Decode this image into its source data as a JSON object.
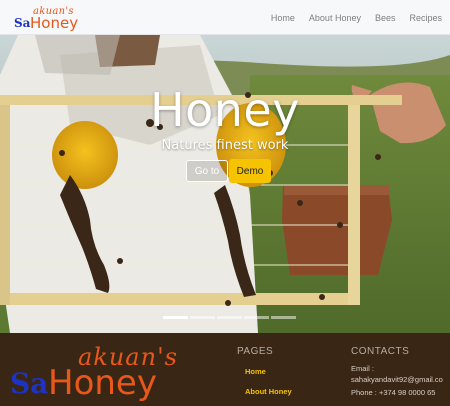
{
  "brand": {
    "small": "akuan's",
    "sa": "Sa",
    "honey": "Honey"
  },
  "nav": {
    "items": [
      "Home",
      "About Honey",
      "Bees",
      "Recipes"
    ]
  },
  "hero": {
    "title": "Honey",
    "subtitle": "Natures finest work",
    "goto_label": "Go to",
    "demo_label": "Demo",
    "slide_count": 5,
    "active_slide": 1
  },
  "footer": {
    "logo": {
      "small": "akuan's",
      "sa": "Sa",
      "honey": "Honey"
    },
    "pages_heading": "PAGES",
    "pages_links": [
      "Home",
      "About Honey"
    ],
    "contacts_heading": "CONTACTS",
    "email_label": "Email :",
    "email": "sahakyandavit92@gmail.co",
    "phone": "Phone : +374 98 0000 65"
  },
  "colors": {
    "brand_orange": "#e8571b",
    "brand_blue": "#1e33c4",
    "accent_yellow": "#f5c300",
    "footer_bg": "#3a2614"
  }
}
